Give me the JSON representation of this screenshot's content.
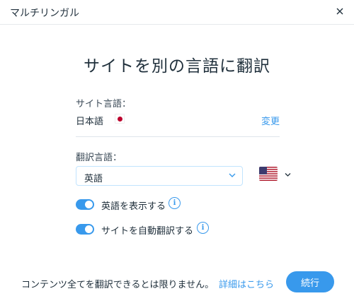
{
  "header": {
    "title": "マルチリンガル",
    "close_icon": "close-icon"
  },
  "heading": "サイトを別の言語に翻訳",
  "site_language": {
    "label": "サイト言語：",
    "value": "日本語",
    "flag": "japan-flag",
    "change_link": "変更"
  },
  "translation_language": {
    "label": "翻訳言語：",
    "selected": "英語",
    "flag": "us-flag"
  },
  "toggles": [
    {
      "label": "英語を表示する",
      "on": true
    },
    {
      "label": "サイトを自動翻訳する",
      "on": true
    }
  ],
  "info_glyph": "i",
  "footer": {
    "note": "コンテンツ全てを翻訳できるとは限りません。",
    "link": "詳細はこちら",
    "continue_button": "続行"
  },
  "colors": {
    "accent": "#3899ec",
    "text": "#20303c",
    "japan_red": "#bc002d"
  }
}
